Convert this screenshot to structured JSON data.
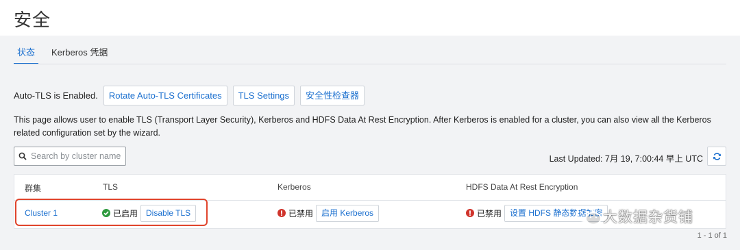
{
  "page": {
    "title": "安全"
  },
  "tabs": [
    {
      "label": "状态",
      "active": true
    },
    {
      "label": "Kerberos 凭据",
      "active": false
    }
  ],
  "tls": {
    "status_text": "Auto-TLS is Enabled.",
    "buttons": [
      "Rotate Auto-TLS Certificates",
      "TLS Settings",
      "安全性检查器"
    ]
  },
  "description": "This page allows user to enable TLS (Transport Layer Security), Kerberos and HDFS Data At Rest Encryption. After Kerberos is enabled for a cluster, you can also view all the Kerberos related configuration set by the wizard.",
  "search": {
    "placeholder": "Search by cluster name",
    "value": ""
  },
  "last_updated": "Last Updated: 7月 19, 7:00:44 早上 UTC",
  "table": {
    "columns": [
      "群集",
      "TLS",
      "Kerberos",
      "HDFS Data At Rest Encryption"
    ],
    "rows": [
      {
        "cluster": "Cluster 1",
        "tls_status": "已启用",
        "tls_action": "Disable TLS",
        "kerberos_status": "已禁用",
        "kerberos_action": "启用 Kerberos",
        "hdfs_status": "已禁用",
        "hdfs_action": "设置 HDFS 静态数据加密"
      }
    ]
  },
  "pagination": "1 - 1 of 1",
  "watermark": "大数据杂货铺",
  "colors": {
    "accent": "#1a6fcf",
    "success": "#2e9a3e",
    "error": "#d0342c",
    "highlight": "#e0442c"
  }
}
